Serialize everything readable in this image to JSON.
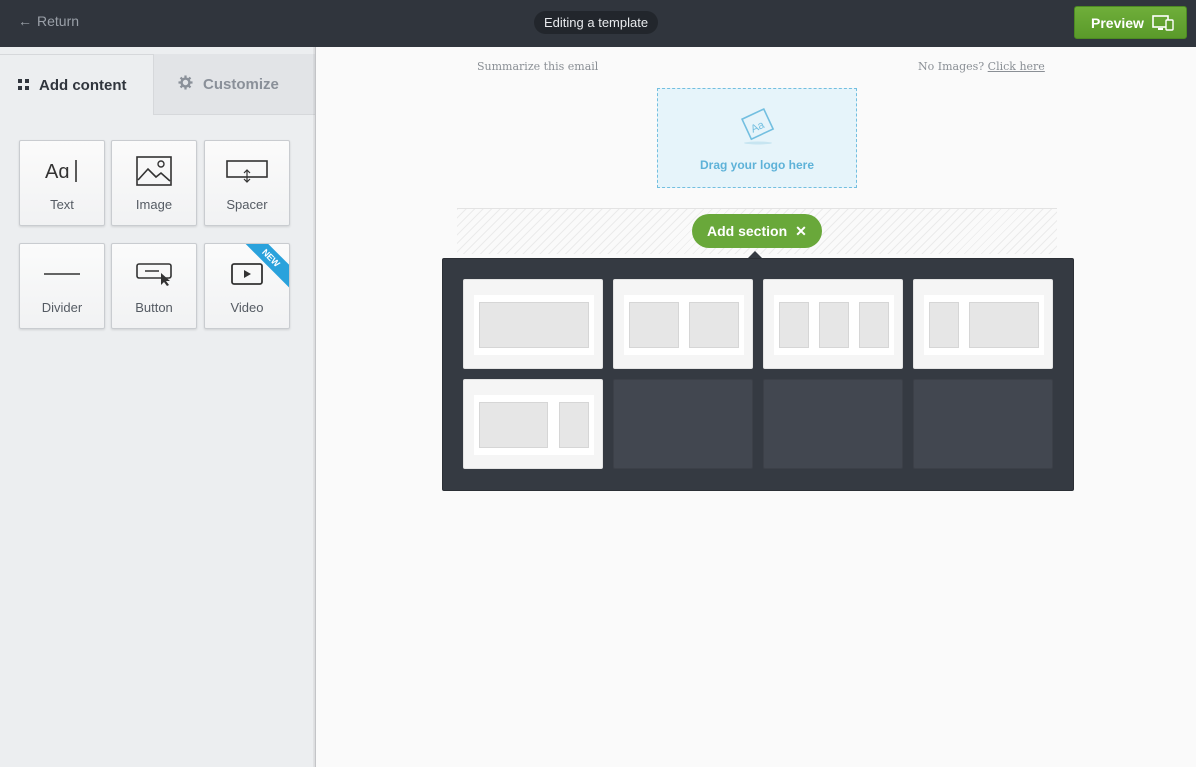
{
  "topbar": {
    "return_label": "Return",
    "title": "Editing a template",
    "preview_label": "Preview"
  },
  "sidebar": {
    "tabs": [
      {
        "label": "Add content",
        "icon": "grid-icon",
        "active": true
      },
      {
        "label": "Customize",
        "icon": "gear-icon",
        "active": false
      }
    ],
    "blocks": [
      {
        "label": "Text",
        "icon": "text-icon"
      },
      {
        "label": "Image",
        "icon": "image-icon"
      },
      {
        "label": "Spacer",
        "icon": "spacer-icon"
      },
      {
        "label": "Divider",
        "icon": "divider-icon"
      },
      {
        "label": "Button",
        "icon": "button-icon"
      },
      {
        "label": "Video",
        "icon": "video-icon",
        "badge": "NEW"
      }
    ]
  },
  "canvas": {
    "summary_text": "Summarize this email",
    "no_images_text": "No Images?",
    "click_here": "Click here",
    "logo_drop_text": "Drag your logo here",
    "add_section_label": "Add section",
    "layouts": [
      {
        "type": "one-column"
      },
      {
        "type": "two-column"
      },
      {
        "type": "three-column"
      },
      {
        "type": "sidebar-left"
      },
      {
        "type": "sidebar-right"
      },
      {
        "type": "empty"
      },
      {
        "type": "empty"
      },
      {
        "type": "empty"
      }
    ]
  },
  "colors": {
    "topbar": "#30353d",
    "accent_green": "#69a83a",
    "accent_blue": "#2aa2dc",
    "panel": "#353a42"
  }
}
